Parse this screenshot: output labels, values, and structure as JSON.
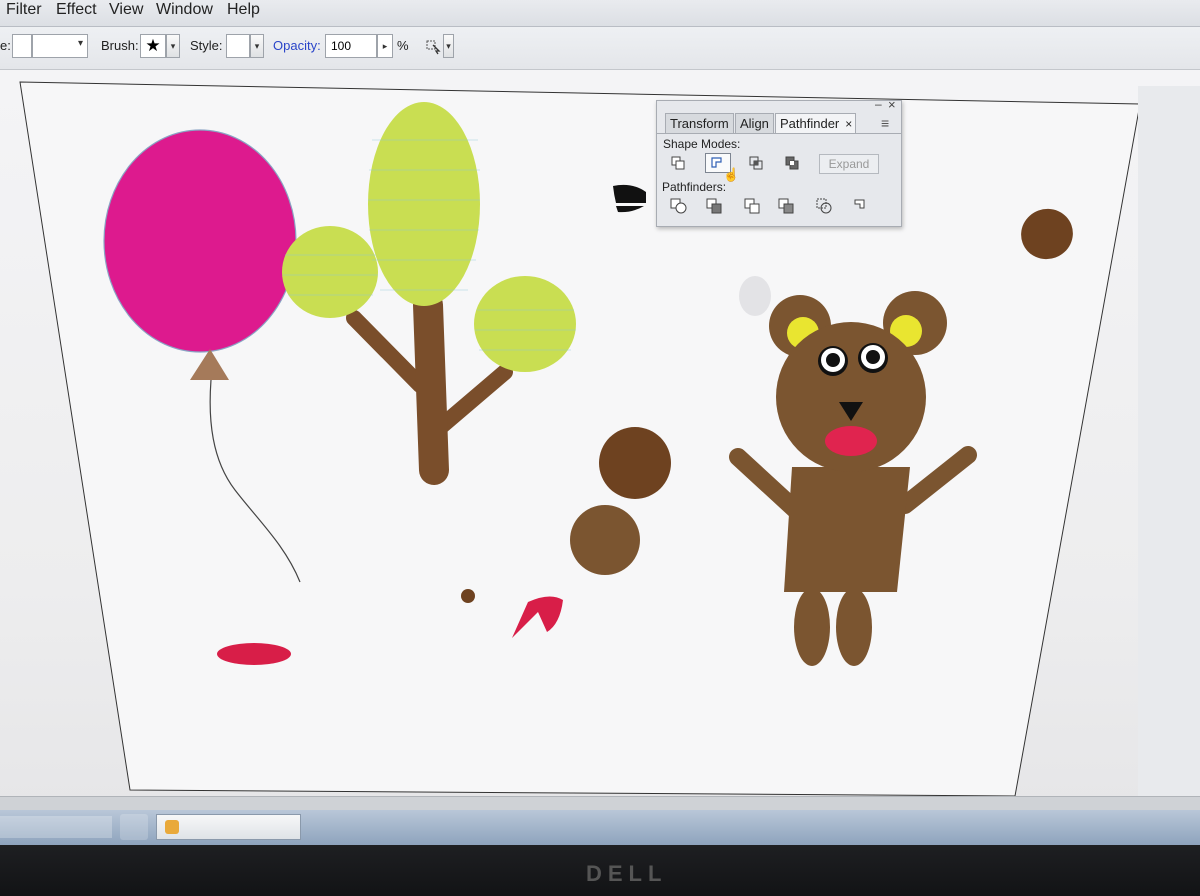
{
  "menubar": {
    "items": [
      {
        "label": "Filter"
      },
      {
        "label": "Effect"
      },
      {
        "label": "View"
      },
      {
        "label": "Window"
      },
      {
        "label": "Help"
      }
    ]
  },
  "controlbar": {
    "stroke_label": "e:",
    "brush_label": "Brush:",
    "brush_glyph": "★",
    "style_label": "Style:",
    "opacity_label": "Opacity:",
    "opacity_value": "100",
    "percent_sign": "%",
    "increment_arrow": "▸",
    "dropdown_arrow": "▾"
  },
  "panel": {
    "tabs": [
      {
        "label": "Transform"
      },
      {
        "label": "Align"
      },
      {
        "label": "Pathfinder"
      }
    ],
    "close_glyph": "×",
    "minimize_glyph": "–",
    "menu_glyph": "≡",
    "shape_modes_label": "Shape Modes:",
    "pathfinders_label": "Pathfinders:",
    "expand_label": "Expand",
    "active_shape_mode_index": 1
  },
  "artwork": {
    "balloon_color": "#dd1a8e",
    "balloon_knot_color": "#a57a5a",
    "tree_foliage_color": "#c9de52",
    "tree_trunk_color": "#7a4e2b",
    "bear_color": "#7b5530",
    "bear_ear_inner_color": "#e9e530",
    "bear_nose_color": "#111111",
    "bear_mouth_color": "#e0244f",
    "loose_shape_brown": "#6e4220",
    "loose_shape_red": "#d81e48"
  },
  "monitor": {
    "brand": "DELL"
  },
  "icons": {
    "cursor": "hand-pointer-icon",
    "brush": "star-icon"
  }
}
